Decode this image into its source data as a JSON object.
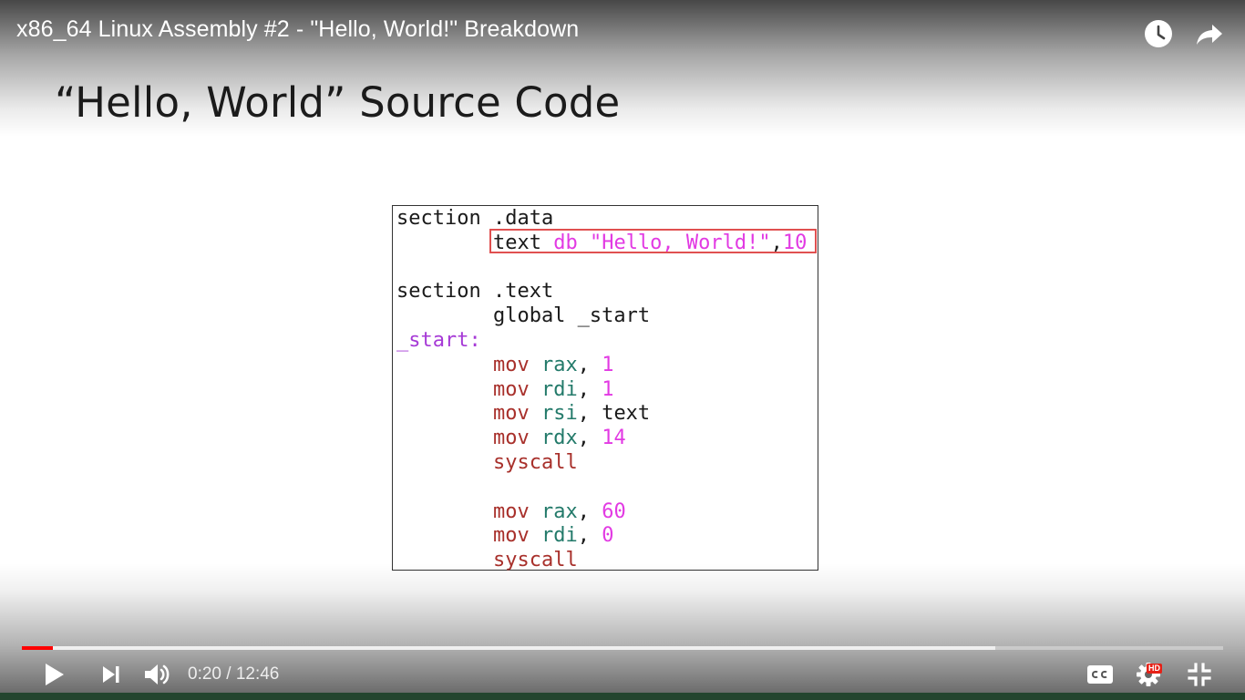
{
  "video": {
    "title": "x86_64 Linux Assembly #2 - \"Hello, World!\" Breakdown"
  },
  "top_icons": [
    "watch-later-icon",
    "share-icon"
  ],
  "slide": {
    "heading": "“Hello, World” Source Code",
    "code_lines": [
      [
        {
          "t": "section .data",
          "c": "plain"
        }
      ],
      [
        {
          "t": "        ",
          "c": "plain"
        },
        {
          "t": "text ",
          "c": "plain"
        },
        {
          "t": "db ",
          "c": "pink"
        },
        {
          "t": "\"Hello, World!\"",
          "c": "pink"
        },
        {
          "t": ",",
          "c": "plain"
        },
        {
          "t": "10",
          "c": "pink"
        }
      ],
      [],
      [
        {
          "t": "section .text",
          "c": "plain"
        }
      ],
      [
        {
          "t": "        global _start",
          "c": "plain"
        }
      ],
      [
        {
          "t": "_start:",
          "c": "purple"
        }
      ],
      [
        {
          "t": "        ",
          "c": "plain"
        },
        {
          "t": "mov ",
          "c": "red"
        },
        {
          "t": "rax",
          "c": "teal"
        },
        {
          "t": ", ",
          "c": "plain"
        },
        {
          "t": "1",
          "c": "pink"
        }
      ],
      [
        {
          "t": "        ",
          "c": "plain"
        },
        {
          "t": "mov ",
          "c": "red"
        },
        {
          "t": "rdi",
          "c": "teal"
        },
        {
          "t": ", ",
          "c": "plain"
        },
        {
          "t": "1",
          "c": "pink"
        }
      ],
      [
        {
          "t": "        ",
          "c": "plain"
        },
        {
          "t": "mov ",
          "c": "red"
        },
        {
          "t": "rsi",
          "c": "teal"
        },
        {
          "t": ", text",
          "c": "plain"
        }
      ],
      [
        {
          "t": "        ",
          "c": "plain"
        },
        {
          "t": "mov ",
          "c": "red"
        },
        {
          "t": "rdx",
          "c": "teal"
        },
        {
          "t": ", ",
          "c": "plain"
        },
        {
          "t": "14",
          "c": "pink"
        }
      ],
      [
        {
          "t": "        ",
          "c": "plain"
        },
        {
          "t": "syscall",
          "c": "red"
        }
      ],
      [],
      [
        {
          "t": "        ",
          "c": "plain"
        },
        {
          "t": "mov ",
          "c": "red"
        },
        {
          "t": "rax",
          "c": "teal"
        },
        {
          "t": ", ",
          "c": "plain"
        },
        {
          "t": "60",
          "c": "pink"
        }
      ],
      [
        {
          "t": "        ",
          "c": "plain"
        },
        {
          "t": "mov ",
          "c": "red"
        },
        {
          "t": "rdi",
          "c": "teal"
        },
        {
          "t": ", ",
          "c": "plain"
        },
        {
          "t": "0",
          "c": "pink"
        }
      ],
      [
        {
          "t": "        ",
          "c": "plain"
        },
        {
          "t": "syscall",
          "c": "red"
        }
      ]
    ],
    "highlighted_line": 1
  },
  "player": {
    "current_time": "0:20",
    "separator": " / ",
    "duration": "12:46",
    "played_fraction": 0.026,
    "buffered_fraction": 0.81,
    "quality_badge": "HD",
    "accent_color": "#ff0000",
    "left_controls": [
      "play-icon",
      "next-icon",
      "volume-icon"
    ],
    "right_controls": [
      "captions-icon",
      "settings-icon",
      "exit-fullscreen-icon"
    ]
  }
}
